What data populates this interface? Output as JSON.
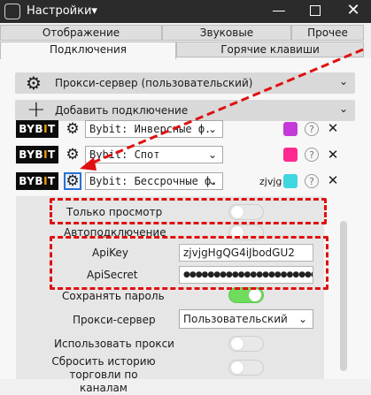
{
  "window": {
    "title": "Настройки",
    "title_chevron": "▾",
    "close_glyph": "✕"
  },
  "tabs": {
    "row1": [
      "Отображение",
      "Звуковые уведомления",
      "Прочее"
    ],
    "row2": [
      "Подключения",
      "Горячие клавиши"
    ],
    "active": "Подключения"
  },
  "sections": {
    "proxy": {
      "label": "Прокси-сервер (пользовательский)",
      "chevron": "⌄"
    },
    "add": {
      "label": "Добавить подключение",
      "chevron": "⌄"
    }
  },
  "connections": [
    {
      "logo_a": "BYB",
      "logo_b": "I",
      "logo_c": "T",
      "select": "Bybit: Инверсные ф.",
      "name": "",
      "color": "#c43ad8",
      "help": "?",
      "close": "✕"
    },
    {
      "logo_a": "BYB",
      "logo_b": "I",
      "logo_c": "T",
      "select": "Bybit: Спот",
      "name": "",
      "color": "#ff2a8f",
      "help": "?",
      "close": "✕"
    },
    {
      "logo_a": "BYB",
      "logo_b": "I",
      "logo_c": "T",
      "select": "Bybit: Бессрочные ф.",
      "name": "zjvjg",
      "color": "#3fd6e0",
      "help": "?",
      "close": "✕"
    }
  ],
  "settings": {
    "readonly": {
      "label": "Только просмотр",
      "on": false
    },
    "autoconnect": {
      "label": "Автоподключение",
      "on": false
    },
    "apikey": {
      "label": "ApiKey",
      "value": "zjvjgHgQG4iJbodGU2"
    },
    "apisecret": {
      "label": "ApiSecret",
      "value": "●●●●●●●●●●●●●●●●●●●●●●●●●●●●●●●●●●●"
    },
    "savepw": {
      "label": "Сохранять пароль",
      "on": true
    },
    "proxyserver": {
      "label": "Прокси-сервер",
      "value": "Пользовательский",
      "chevron": "⌄"
    },
    "useproxy": {
      "label": "Использовать прокси",
      "on": false
    },
    "reset": {
      "label": "Сбросить историю торговли по каналам",
      "on": false
    }
  },
  "colors": {
    "highlight": "#e01010",
    "toggle_on": "#6fdc5e",
    "title_bar": "#2b2b2b"
  }
}
